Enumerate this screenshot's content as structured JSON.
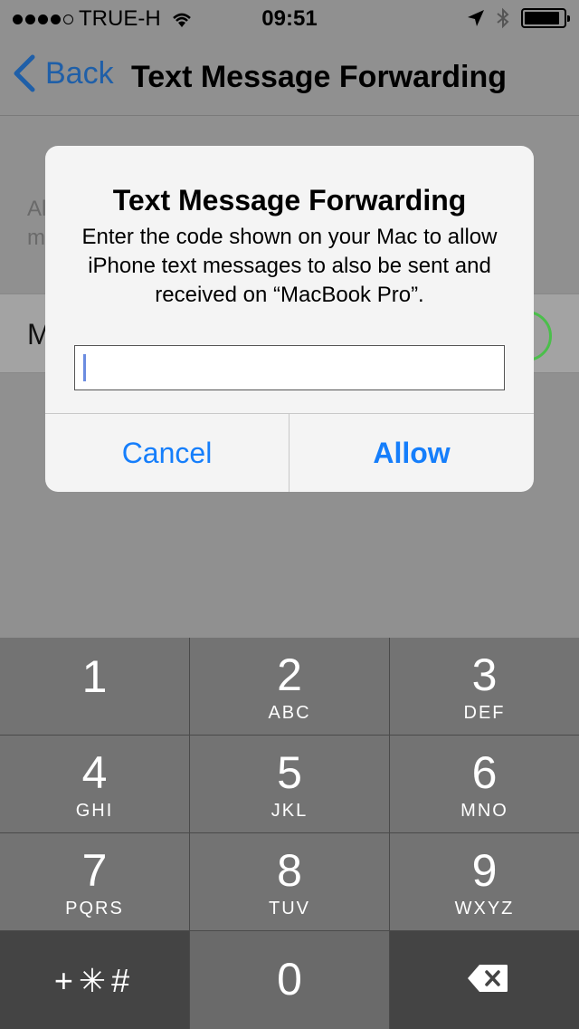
{
  "status_bar": {
    "carrier": "TRUE-H",
    "time": "09:51",
    "signal_dots_filled": 4,
    "signal_dots_total": 5
  },
  "nav": {
    "back_label": "Back",
    "title": "Text Message Forwarding"
  },
  "background": {
    "text_line1": "Al",
    "text_line2": "m",
    "cell_label": "M"
  },
  "alert": {
    "title": "Text Message Forwarding",
    "message": "Enter the code shown on your Mac to allow iPhone text messages to also be sent and received on “MacBook Pro”.",
    "input_value": "",
    "cancel_label": "Cancel",
    "allow_label": "Allow"
  },
  "keypad": {
    "keys": [
      {
        "digit": "1",
        "letters": ""
      },
      {
        "digit": "2",
        "letters": "ABC"
      },
      {
        "digit": "3",
        "letters": "DEF"
      },
      {
        "digit": "4",
        "letters": "GHI"
      },
      {
        "digit": "5",
        "letters": "JKL"
      },
      {
        "digit": "6",
        "letters": "MNO"
      },
      {
        "digit": "7",
        "letters": "PQRS"
      },
      {
        "digit": "8",
        "letters": "TUV"
      },
      {
        "digit": "9",
        "letters": "WXYZ"
      }
    ],
    "symbols_label": "+✳#",
    "zero": "0"
  },
  "colors": {
    "accent": "#157efb",
    "back_link": "#1f5fa8",
    "toggle_on": "#4bbf4b"
  },
  "icons": [
    "wifi-icon",
    "location-arrow-icon",
    "bluetooth-icon",
    "battery-icon",
    "chevron-left-icon",
    "delete-backspace-icon"
  ]
}
